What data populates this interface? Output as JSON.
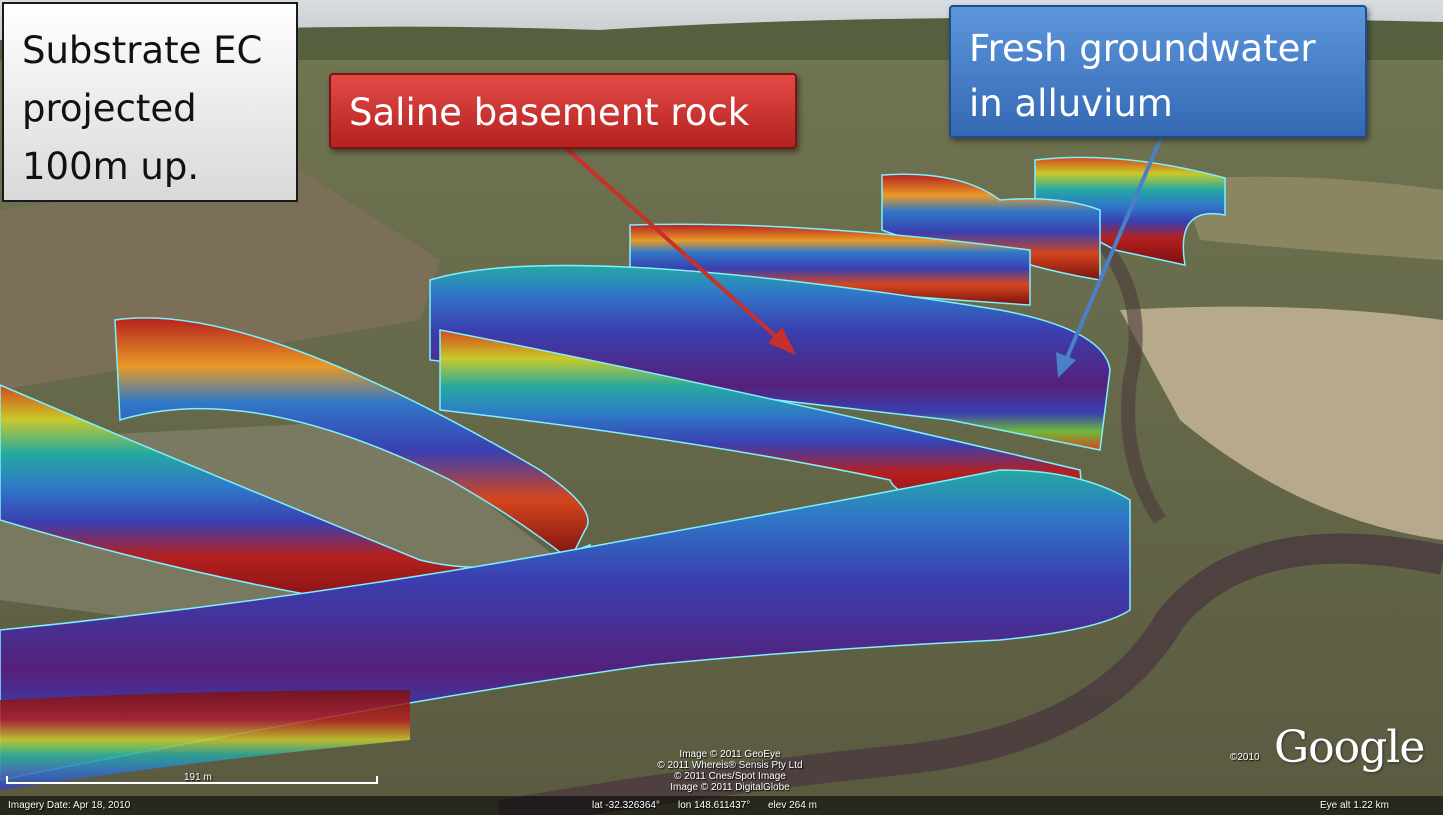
{
  "callouts": {
    "substrate": {
      "lines": [
        "Substrate EC",
        "projected",
        "100m up."
      ]
    },
    "saline": {
      "label": "Saline basement rock",
      "color": "#c9302c"
    },
    "fresh": {
      "lines": [
        "Fresh groundwater",
        "in alluvium"
      ],
      "color": "#4a80c8"
    }
  },
  "imagery_credits": [
    "Image © 2011 GeoEye",
    "© 2011 Whereis® Sensis Pty Ltd",
    "© 2011 Cnes/Spot Image",
    "Image © 2011 DigitalGlobe"
  ],
  "status_bar": {
    "imagery_date": "Imagery Date: Apr 18, 2010",
    "lat": "lat  -32.326364°",
    "lon": "lon  148.611437°",
    "elev": "elev  264 m",
    "eye_alt": "Eye alt    1.22 km"
  },
  "scale": {
    "label": "191 m"
  },
  "logo": {
    "year": "©2010",
    "text": "Google"
  },
  "colors": {
    "ec_palette": [
      "#7a1010",
      "#b52020",
      "#d4461d",
      "#e89a26",
      "#c9c92a",
      "#6fb83a",
      "#25a9a0",
      "#2f78c8",
      "#3a3fb0",
      "#55207a"
    ],
    "outline": "#7ff0ff"
  }
}
